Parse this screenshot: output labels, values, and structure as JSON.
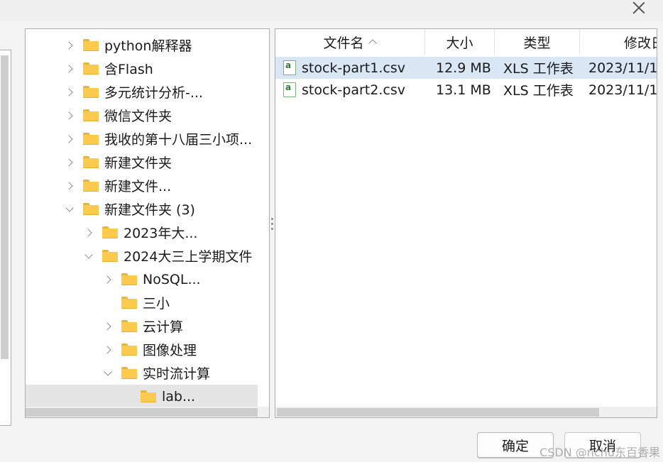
{
  "tree": {
    "items": [
      {
        "label": "python解释器",
        "expander": "right",
        "depth": 0
      },
      {
        "label": "含Flash",
        "expander": "right",
        "depth": 0
      },
      {
        "label": "多元统计分析-...",
        "expander": "right",
        "depth": 0
      },
      {
        "label": "微信文件夹",
        "expander": "right",
        "depth": 0
      },
      {
        "label": "我收的第十八届三小项...",
        "expander": "right",
        "depth": 0
      },
      {
        "label": "新建文件夹",
        "expander": "right",
        "depth": 0
      },
      {
        "label": "新建文件...",
        "expander": "right",
        "depth": 0
      },
      {
        "label": "新建文件夹 (3)",
        "expander": "down",
        "depth": 0
      },
      {
        "label": "2023年大...",
        "expander": "right",
        "depth": 1
      },
      {
        "label": "2024大三上学期文件",
        "expander": "down",
        "depth": 1
      },
      {
        "label": "NoSQL...",
        "expander": "right",
        "depth": 2
      },
      {
        "label": "三小",
        "expander": "none",
        "depth": 2
      },
      {
        "label": "云计算",
        "expander": "right",
        "depth": 2
      },
      {
        "label": "图像处理",
        "expander": "right",
        "depth": 2
      },
      {
        "label": "实时流计算",
        "expander": "down",
        "depth": 2
      },
      {
        "label": "lab...",
        "expander": "none",
        "depth": 3,
        "selected": true
      }
    ]
  },
  "files": {
    "columns": [
      {
        "label": "文件名",
        "sorted": "ascending"
      },
      {
        "label": "大小"
      },
      {
        "label": "类型"
      },
      {
        "label": "修改日"
      }
    ],
    "rows": [
      {
        "name": "stock-part1.csv",
        "size": "12.9 MB",
        "type": "XLS 工作表",
        "modified": "2023/11/1",
        "selected": true
      },
      {
        "name": "stock-part2.csv",
        "size": "13.1 MB",
        "type": "XLS 工作表",
        "modified": "2023/11/1",
        "selected": false
      }
    ]
  },
  "buttons": {
    "ok": "确定",
    "cancel": "取消"
  },
  "watermark": "CSDN @nchu东百香果",
  "colors": {
    "selected_row": "#d9e6f4",
    "tree_selected": "#e5e5e5",
    "folder": "#fcca4c"
  }
}
